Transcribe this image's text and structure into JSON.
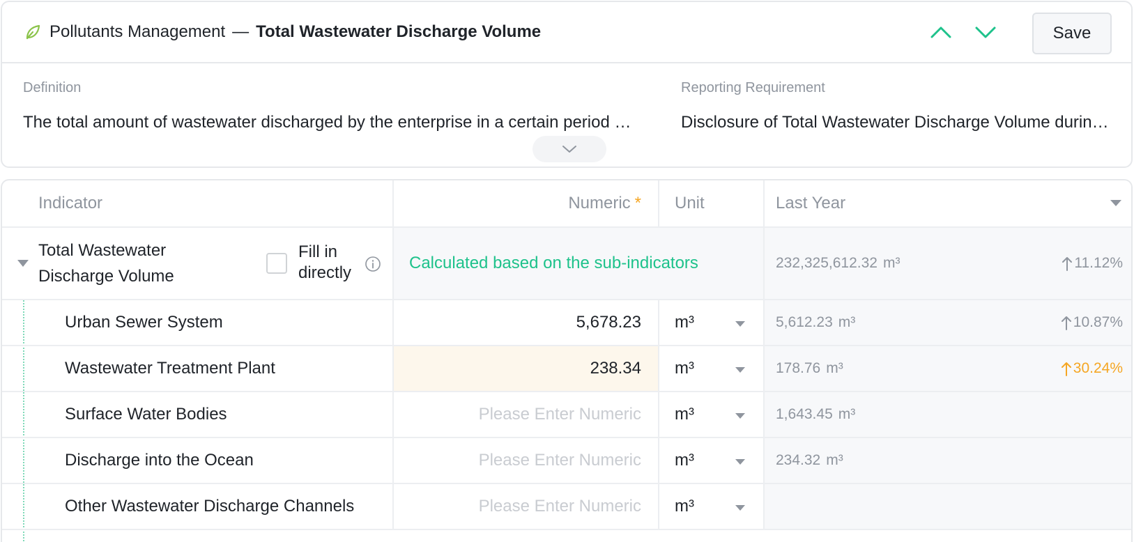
{
  "header": {
    "section": "Pollutants Management",
    "separator": "—",
    "title": "Total Wastewater Discharge Volume",
    "save_label": "Save"
  },
  "meta": {
    "definition_label": "Definition",
    "definition_text": "The total amount of wastewater discharged by the enterprise in a certain period of time",
    "requirement_label": "Reporting Requirement",
    "requirement_text": "Disclosure of Total Wastewater Discharge Volume during the reporting period"
  },
  "table": {
    "headers": {
      "indicator": "Indicator",
      "numeric": "Numeric",
      "required_mark": "*",
      "unit": "Unit",
      "last_year": "Last Year"
    },
    "parent": {
      "name": "Total Wastewater Discharge Volume",
      "fill_label": "Fill in directly",
      "fill_checked": false,
      "calc_text": "Calculated based on the sub-indicators",
      "last_value": "232,325,612.32",
      "last_unit": "m³",
      "change": "11.12%"
    },
    "rows": [
      {
        "name": "Urban Sewer System",
        "value": "5,678.23",
        "placeholder": "",
        "unit": "m³",
        "last_value": "5,612.23",
        "last_unit": "m³",
        "change": "10.87%",
        "change_color": "grey"
      },
      {
        "name": "Wastewater Treatment Plant",
        "value": "238.34",
        "placeholder": "",
        "unit": "m³",
        "last_value": "178.76",
        "last_unit": "m³",
        "change": "30.24%",
        "change_color": "orange"
      },
      {
        "name": "Surface Water Bodies",
        "value": "",
        "placeholder": "Please Enter Numeric",
        "unit": "m³",
        "last_value": "1,643.45",
        "last_unit": "m³",
        "change": "",
        "change_color": ""
      },
      {
        "name": "Discharge into the Ocean",
        "value": "",
        "placeholder": "Please Enter Numeric",
        "unit": "m³",
        "last_value": "234.32",
        "last_unit": "m³",
        "change": "",
        "change_color": ""
      },
      {
        "name": "Other Wastewater Discharge Channels",
        "value": "",
        "placeholder": "Please Enter Numeric",
        "unit": "m³",
        "last_value": "",
        "last_unit": "",
        "change": "",
        "change_color": ""
      }
    ]
  },
  "colors": {
    "accent_green": "#1ec28b",
    "warning_orange": "#f5a623",
    "highlight_bg": "#fdf7ec"
  }
}
